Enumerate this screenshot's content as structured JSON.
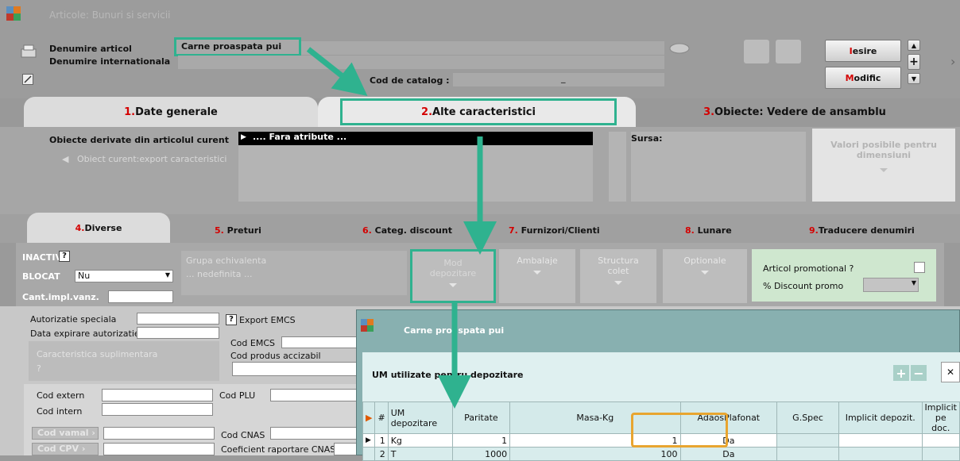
{
  "window": {
    "title": "Articole: Bunuri si servicii"
  },
  "header": {
    "name_label": "Denumire articol",
    "intl_label": "Denumire internationala",
    "name_value": "Carne proaspata pui",
    "catalog_label": "Cod de catalog :",
    "catalog_value": "_",
    "exit_button": {
      "hotkey": "I",
      "rest": "esire"
    },
    "modify_button": {
      "hotkey": "M",
      "rest": "odific"
    },
    "plus": "+"
  },
  "main_tabs": [
    {
      "num": "1.",
      "label": " Date generale"
    },
    {
      "num": "2.",
      "label": " Alte caracteristici"
    },
    {
      "num": "3.",
      "label": " Obiecte: Vedere de ansamblu"
    }
  ],
  "derived": {
    "title": "Obiecte derivate din articolul curent",
    "current_obj": "Obiect curent:export caracteristici",
    "attr_value": ".... Fara atribute ...",
    "source_label": "Sursa:",
    "possible_values": "Valori posibile pentru dimensiuni"
  },
  "sub_tabs": [
    {
      "num": "4.",
      "label": " Diverse"
    },
    {
      "num": "5.",
      "label": " Preturi"
    },
    {
      "num": "6.",
      "label": " Categ. discount"
    },
    {
      "num": "7.",
      "label": " Furnizori/Clienti"
    },
    {
      "num": "8.",
      "label": " Lunare"
    },
    {
      "num": "9.",
      "label": "Traducere denumiri"
    }
  ],
  "diverse": {
    "inactiv_label": "INACTIV",
    "question": "?",
    "blocat_label": "BLOCAT",
    "blocat_value": "Nu",
    "cant_label": "Cant.impl.vanz.",
    "grupa_label": "Grupa echivalenta",
    "grupa_value": "... nedefinita ...",
    "mod_depozitare": "Mod depozitare",
    "ambalaje": "Ambalaje",
    "structura": "Structura colet",
    "optionale": "Optionale",
    "promo_label": "Articol promotional ?",
    "discount_label": "% Discount promo"
  },
  "lower": {
    "autorizatie": "Autorizatie speciala",
    "data_expirare": "Data expirare autorizatie",
    "caracteristica": "Caracteristica suplimentara",
    "question": "?",
    "export_emcs": "Export EMCS",
    "cod_emcs": "Cod EMCS",
    "cod_accizabil": "Cod produs accizabil",
    "cod_extern": "Cod extern",
    "cod_intern": "Cod intern",
    "cod_plu": "Cod PLU",
    "cod_vamal": "Cod vamal",
    "cod_cpv": "Cod CPV",
    "cod_cnas": "Cod CNAS",
    "coef_cnas": "Coeficient raportare CNAS"
  },
  "popup": {
    "title": "Carne proaspata pui",
    "section_title": "UM utilizate pentru depozitare",
    "columns": [
      "#",
      "UM depozitare",
      "Paritate",
      "Masa-Kg",
      "AdaosPlafonat",
      "G.Spec",
      "Implicit depozit.",
      "Implicit pe doc."
    ],
    "rows": [
      {
        "n": "1",
        "um": "Kg",
        "paritate": "1",
        "masa": "1",
        "adaos": "Da"
      },
      {
        "n": "2",
        "um": "T",
        "paritate": "1000",
        "masa": "100",
        "adaos": "Da"
      }
    ],
    "plus": "+",
    "minus": "−",
    "close": "✕"
  },
  "colors": {
    "teal": "#2fb28f",
    "orange": "#e8a530",
    "tab_red": "#d40000"
  }
}
